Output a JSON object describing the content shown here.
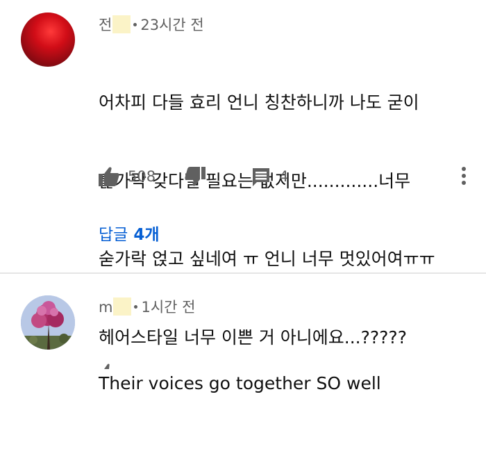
{
  "comments": [
    {
      "author_initial": "전",
      "timestamp": "23시간 전",
      "text_lines": [
        "어차피 다들 효리 언니 칭찬하니까 나도 굳이",
        "훑가락 갖다댈 필요는 없지만.............너무",
        "숟가락 얹고 싶네여 ㅠ 언니 너무 멋있어여ㅠㅠ",
        "헤어스타일 너무 이쁜 거 아니에요...?????"
      ],
      "like_count": "508",
      "reply_count": "4",
      "replies_link": {
        "label": "답글",
        "count": "4개"
      },
      "icons": {
        "like": "thumbs-up-icon",
        "dislike": "thumbs-down-icon",
        "reply": "comment-icon",
        "more": "more-vert-icon"
      }
    },
    {
      "author_initial": "m",
      "timestamp": "1시간 전",
      "text_lines": [
        "Their voices go together SO well"
      ]
    }
  ],
  "colors": {
    "link_blue": "#065fd4",
    "meta_gray": "#606060",
    "icon_gray": "#606060",
    "name_redaction": "#fbf3c7"
  }
}
